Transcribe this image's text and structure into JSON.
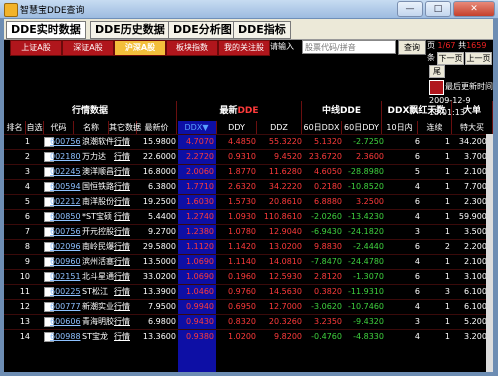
{
  "window": {
    "title": "智慧宝DDE查询",
    "min": "—",
    "max": "□",
    "close": "✕"
  },
  "main_tabs": [
    "DDE实时数据",
    "DDE历史数据",
    "DDE分析图",
    "DDE指标"
  ],
  "market_tabs": [
    "上证A股",
    "深证A股",
    "沪深A股",
    "板块指数",
    "我的关注股"
  ],
  "search": {
    "label": "请输入",
    "placeholder": "股票代码/拼音",
    "button": "查询"
  },
  "pager": {
    "label_page": "页",
    "current": "1/67",
    "label_total": "共",
    "total": "1659",
    "label_tiao": "条",
    "btn_prev": "下一页",
    "btn_next": "上一页",
    "btn_last": "尾页",
    "refresh": "最后更新时间",
    "date": "2009-12-9",
    "time": "15:01:13"
  },
  "colors": {
    "red": "#ff3b3b",
    "green": "#3fd23f",
    "ddx_bg": "#0d0fa5",
    "header_bg": "#000000"
  },
  "table": {
    "group_headers": {
      "market": "行情数据",
      "latest": "最新",
      "latest_sub": "DDE",
      "mid": "中线DDE",
      "ddx_days": "DDX飘红天数",
      "big": "大单"
    },
    "columns": [
      "排名",
      "自选",
      "代码",
      "名称",
      "其它数据",
      "最新价",
      "DDX▼",
      "DDY",
      "DDZ",
      "60日DDX",
      "60日DDY",
      "10日内",
      "连续",
      "特大买"
    ],
    "rows": [
      {
        "rank": "1",
        "code": "600756",
        "name": "浪潮软件",
        "hq": "行情",
        "price": "15.9800",
        "ddx": "4.7070",
        "ddy": "4.4850",
        "ddz": "55.3220",
        "ddx60": "5.1320",
        "ddy60": "-2.7250",
        "d10": "6",
        "lx": "1",
        "tdm": "34.2000"
      },
      {
        "rank": "2",
        "code": "002180",
        "name": "万力达",
        "hq": "行情",
        "price": "22.6000",
        "ddx": "2.2720",
        "ddy": "0.9310",
        "ddz": "9.4520",
        "ddx60": "23.6720",
        "ddy60": "2.3600",
        "d10": "6",
        "lx": "1",
        "tdm": "3.7000"
      },
      {
        "rank": "3",
        "code": "002245",
        "name": "澳洋顺昌",
        "hq": "行情",
        "price": "16.8000",
        "ddx": "2.0060",
        "ddy": "1.8770",
        "ddz": "11.6280",
        "ddx60": "4.6050",
        "ddy60": "-28.8980",
        "d10": "5",
        "lx": "1",
        "tdm": "2.1000"
      },
      {
        "rank": "4",
        "code": "600594",
        "name": "国恒铁路",
        "hq": "行情",
        "price": "6.3800",
        "ddx": "1.7710",
        "ddy": "2.6320",
        "ddz": "34.2220",
        "ddx60": "0.2180",
        "ddy60": "-10.8520",
        "d10": "4",
        "lx": "1",
        "tdm": "7.7000"
      },
      {
        "rank": "5",
        "code": "002212",
        "name": "南洋股份",
        "hq": "行情",
        "price": "19.2500",
        "ddx": "1.6030",
        "ddy": "1.5730",
        "ddz": "20.8610",
        "ddx60": "6.8880",
        "ddy60": "3.2500",
        "d10": "6",
        "lx": "1",
        "tdm": "2.3000"
      },
      {
        "rank": "6",
        "code": "600850",
        "name": "*ST宝硕",
        "hq": "行情",
        "price": "5.4400",
        "ddx": "1.2740",
        "ddy": "1.0930",
        "ddz": "110.8610",
        "ddx60": "-2.0260",
        "ddy60": "-13.4230",
        "d10": "4",
        "lx": "1",
        "tdm": "59.9000"
      },
      {
        "rank": "7",
        "code": "600756",
        "name": "开元控股",
        "hq": "行情",
        "price": "9.2700",
        "ddx": "1.2380",
        "ddy": "1.0780",
        "ddz": "12.9040",
        "ddx60": "-6.9430",
        "ddy60": "-24.1820",
        "d10": "3",
        "lx": "1",
        "tdm": "3.5000"
      },
      {
        "rank": "8",
        "code": "002096",
        "name": "南岭民爆",
        "hq": "行情",
        "price": "29.5800",
        "ddx": "1.1120",
        "ddy": "1.1420",
        "ddz": "13.0200",
        "ddx60": "9.8830",
        "ddy60": "-2.4440",
        "d10": "6",
        "lx": "2",
        "tdm": "2.2000"
      },
      {
        "rank": "9",
        "code": "600960",
        "name": "滨州活塞",
        "hq": "行情",
        "price": "13.5000",
        "ddx": "1.0690",
        "ddy": "1.1140",
        "ddz": "14.0810",
        "ddx60": "-7.8470",
        "ddy60": "-24.4780",
        "d10": "4",
        "lx": "1",
        "tdm": "2.1000"
      },
      {
        "rank": "10",
        "code": "002151",
        "name": "北斗星通",
        "hq": "行情",
        "price": "33.0200",
        "ddx": "1.0690",
        "ddy": "0.1960",
        "ddz": "12.5930",
        "ddx60": "2.8120",
        "ddy60": "-1.3070",
        "d10": "6",
        "lx": "1",
        "tdm": "3.1000"
      },
      {
        "rank": "11",
        "code": "600225",
        "name": "ST松江",
        "hq": "行情",
        "price": "13.3900",
        "ddx": "1.0460",
        "ddy": "0.9760",
        "ddz": "14.5630",
        "ddx60": "0.3820",
        "ddy60": "-11.9310",
        "d10": "6",
        "lx": "3",
        "tdm": "6.1000"
      },
      {
        "rank": "12",
        "code": "600777",
        "name": "新潮实业",
        "hq": "行情",
        "price": "7.9500",
        "ddx": "0.9940",
        "ddy": "0.6950",
        "ddz": "12.7000",
        "ddx60": "-3.0620",
        "ddy60": "-10.7460",
        "d10": "4",
        "lx": "1",
        "tdm": "6.1000"
      },
      {
        "rank": "13",
        "code": "600606",
        "name": "青海明胶",
        "hq": "行情",
        "price": "6.9800",
        "ddx": "0.9430",
        "ddy": "0.8320",
        "ddz": "20.3260",
        "ddx60": "3.2350",
        "ddy60": "-9.4320",
        "d10": "3",
        "lx": "1",
        "tdm": "5.2000"
      },
      {
        "rank": "14",
        "code": "600988",
        "name": "ST宝龙",
        "hq": "行情",
        "price": "13.3600",
        "ddx": "0.9380",
        "ddy": "1.0200",
        "ddz": "9.8200",
        "ddx60": "-0.4760",
        "ddy60": "-4.8330",
        "d10": "4",
        "lx": "1",
        "tdm": "3.2000"
      }
    ]
  }
}
